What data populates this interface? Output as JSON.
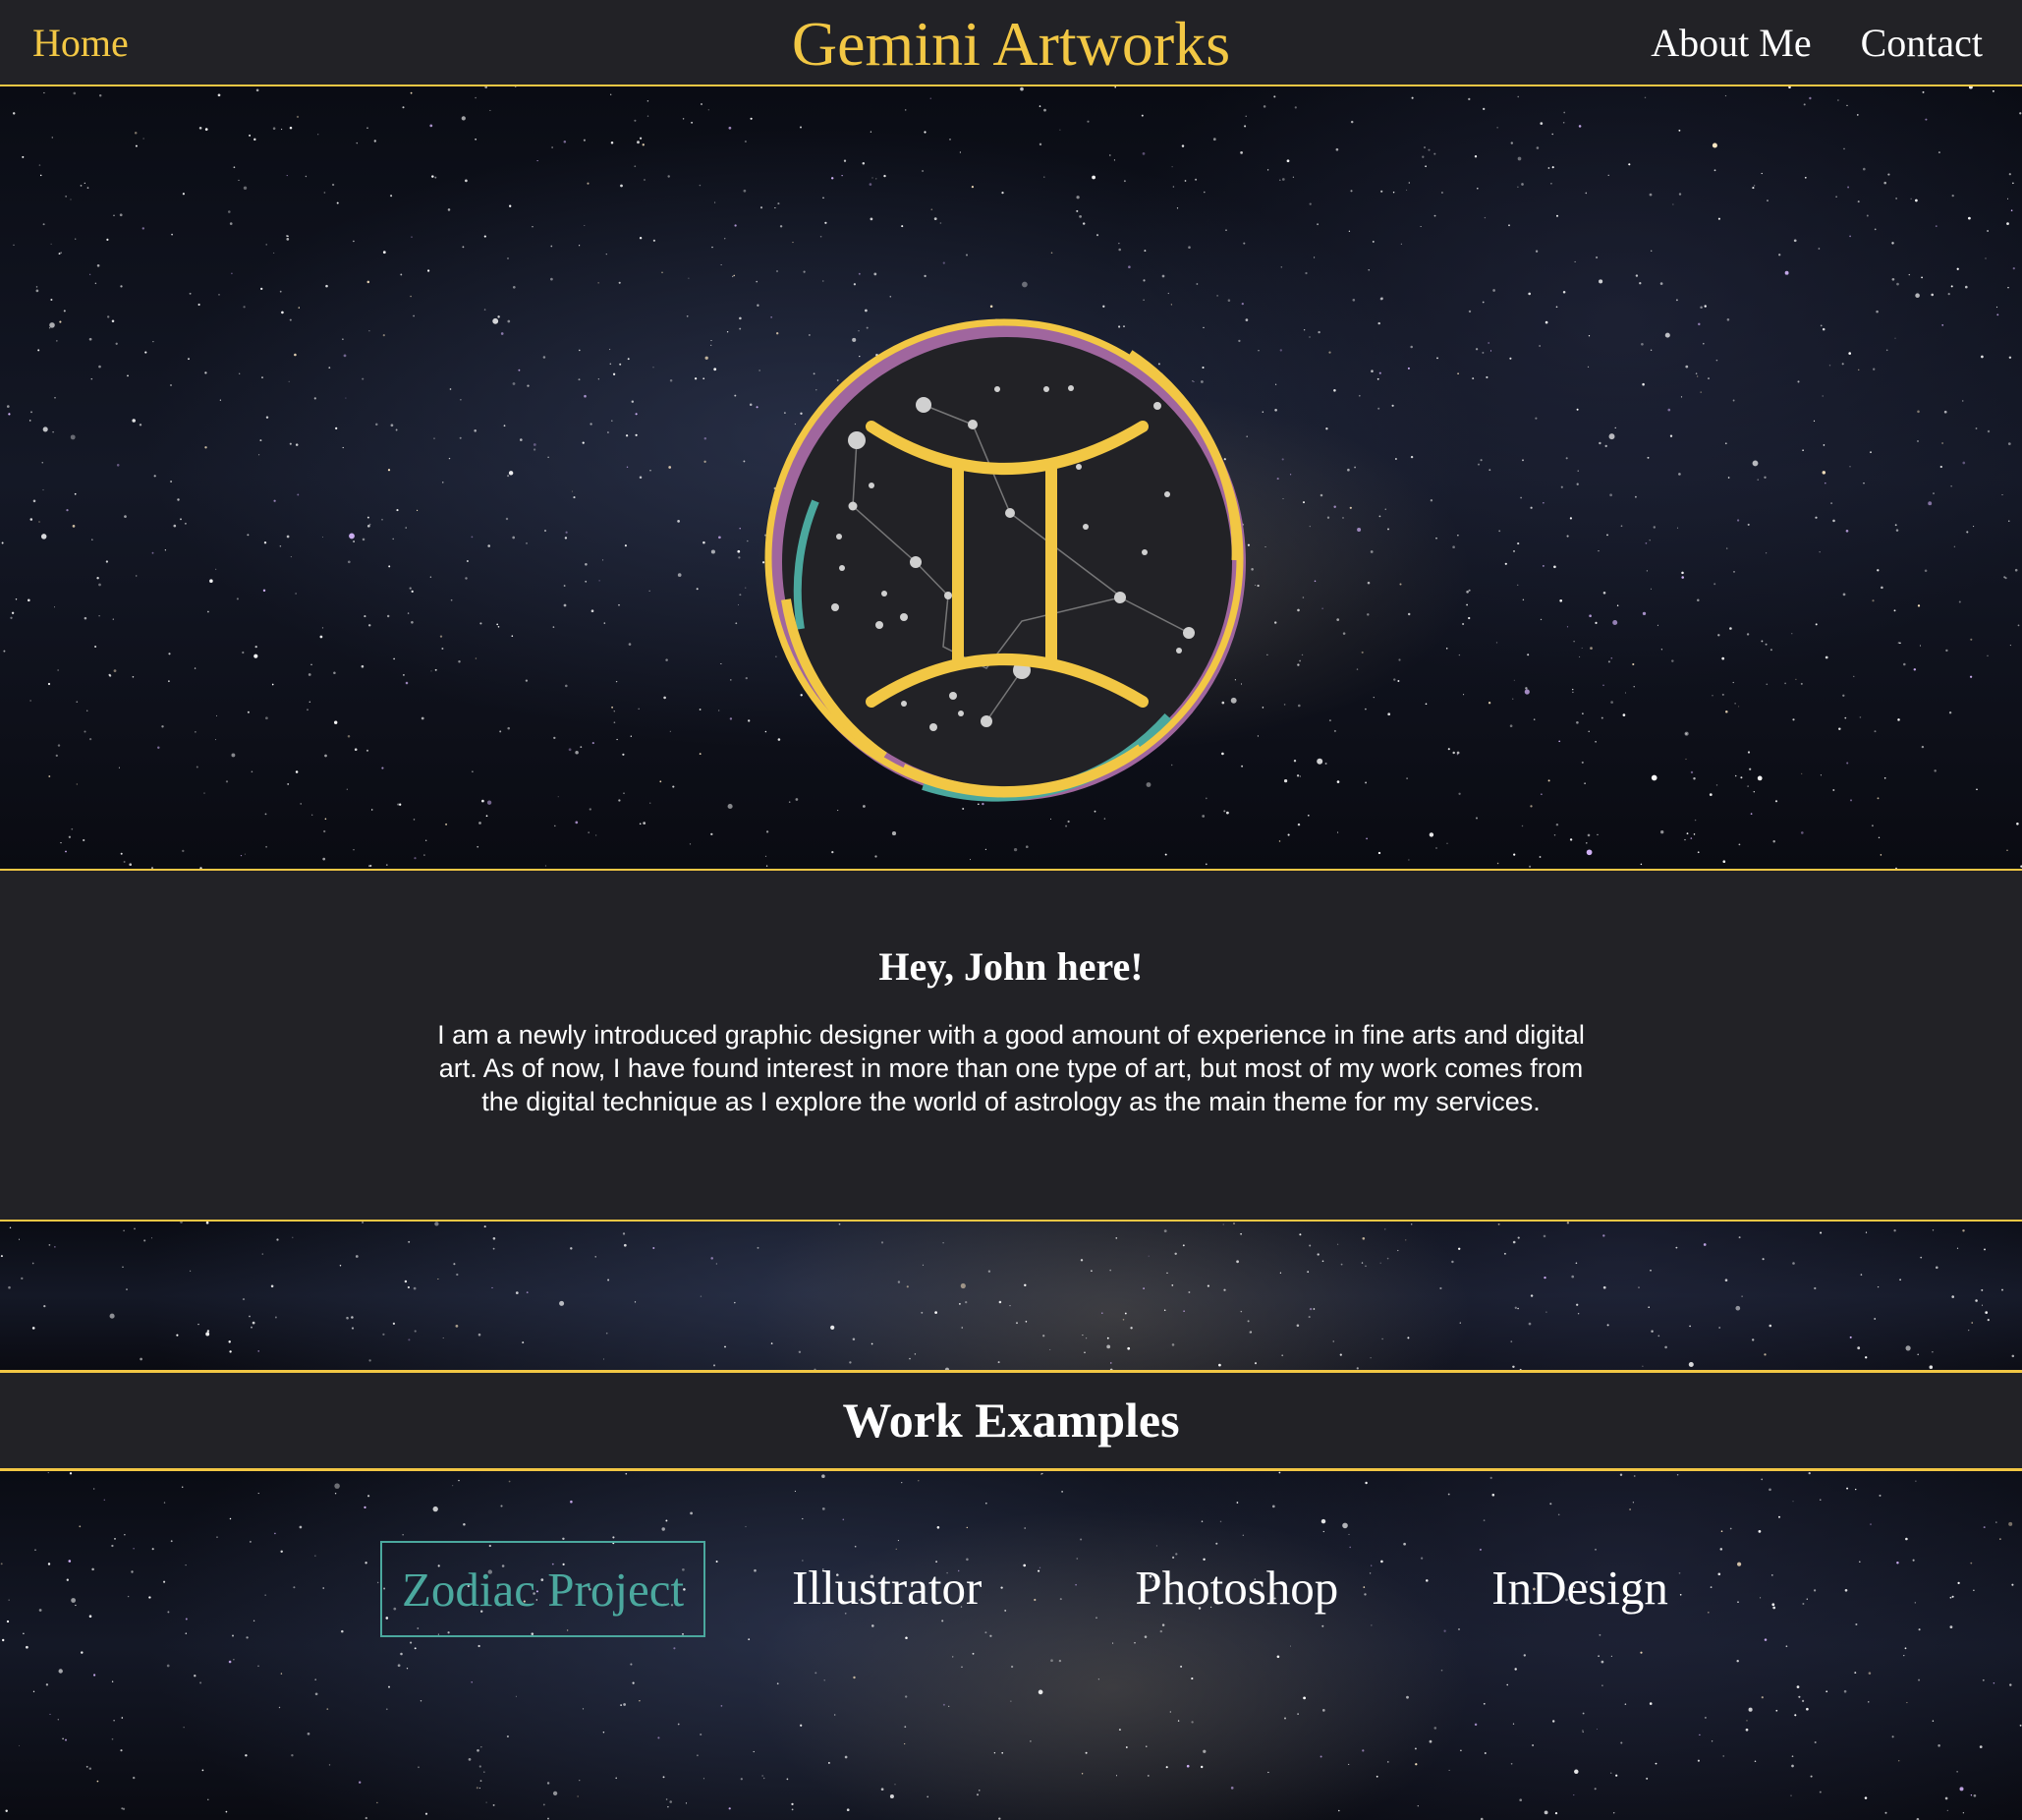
{
  "header": {
    "home_label": "Home",
    "brand": "Gemini Artworks",
    "nav": [
      {
        "label": "About Me"
      },
      {
        "label": "Contact"
      }
    ]
  },
  "hero": {
    "emblem_icon": "gemini-zodiac-icon",
    "ring_colors": [
      "#f2c744",
      "#a0669e",
      "#4ba89e"
    ]
  },
  "intro": {
    "heading": "Hey, John here!",
    "body": "I am a newly introduced graphic designer with a good amount of experience in fine arts and digital art. As of now, I have found interest in more than one type of art, but most of my work comes from the digital technique as I explore the world of astrology as the main theme for my services."
  },
  "work": {
    "heading": "Work Examples",
    "tabs": [
      {
        "label": "Zodiac Project",
        "active": true
      },
      {
        "label": "Illustrator",
        "active": false
      },
      {
        "label": "Photoshop",
        "active": false
      },
      {
        "label": "InDesign",
        "active": false
      }
    ]
  },
  "colors": {
    "accent": "#f2c744",
    "panel": "#222226",
    "active_tab": "#4ba89e",
    "ring_purple": "#a0669e"
  }
}
